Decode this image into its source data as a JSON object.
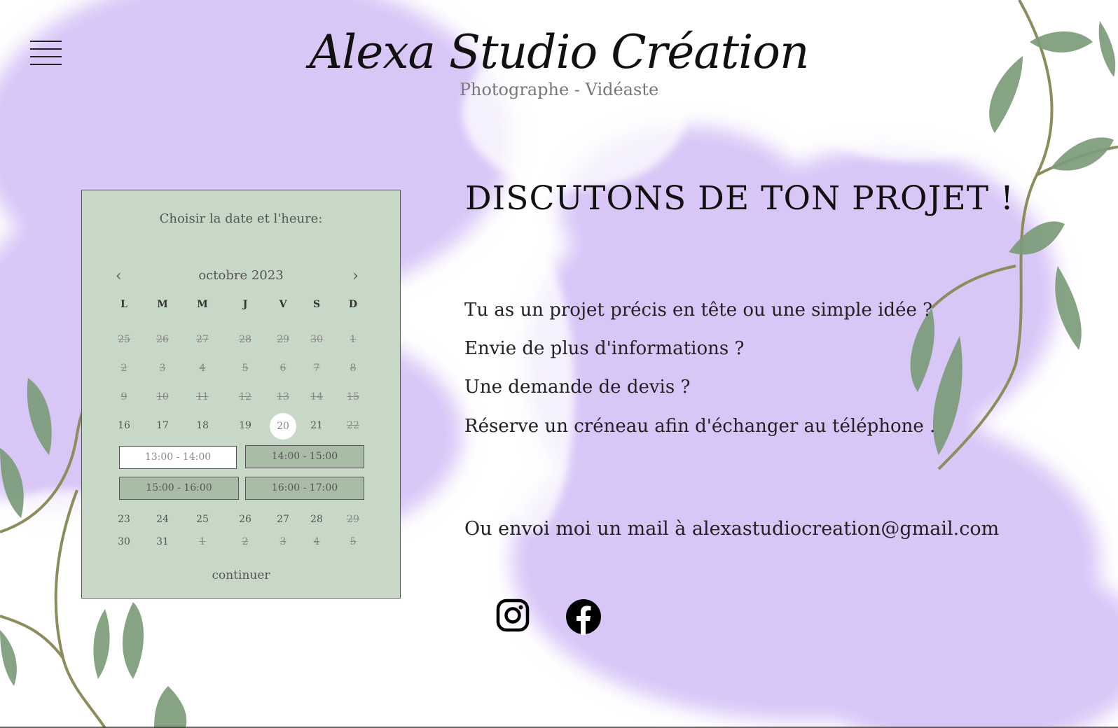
{
  "brand": {
    "title": "Alexa Studio Création",
    "subtitle": "Photographe - Vidéaste"
  },
  "booking": {
    "title": "Choisir la date et l'heure:",
    "month": "octobre 2023",
    "weekdays": [
      "L",
      "M",
      "M",
      "J",
      "V",
      "S",
      "D"
    ],
    "weeks": [
      [
        {
          "d": "25",
          "off": true
        },
        {
          "d": "26",
          "off": true
        },
        {
          "d": "27",
          "off": true
        },
        {
          "d": "28",
          "off": true
        },
        {
          "d": "29",
          "off": true
        },
        {
          "d": "30",
          "off": true
        },
        {
          "d": "1",
          "off": true
        }
      ],
      [
        {
          "d": "2",
          "off": true
        },
        {
          "d": "3",
          "off": true
        },
        {
          "d": "4",
          "off": true
        },
        {
          "d": "5",
          "off": true
        },
        {
          "d": "6",
          "off": true
        },
        {
          "d": "7",
          "off": true
        },
        {
          "d": "8",
          "off": true
        }
      ],
      [
        {
          "d": "9",
          "off": true
        },
        {
          "d": "10",
          "off": true
        },
        {
          "d": "11",
          "off": true
        },
        {
          "d": "12",
          "off": true
        },
        {
          "d": "13",
          "off": true
        },
        {
          "d": "14",
          "off": true
        },
        {
          "d": "15",
          "off": true
        }
      ],
      [
        {
          "d": "16",
          "off": false
        },
        {
          "d": "17",
          "off": false
        },
        {
          "d": "18",
          "off": false
        },
        {
          "d": "19",
          "off": false
        },
        {
          "d": "20",
          "off": false,
          "selected": true
        },
        {
          "d": "21",
          "off": false
        },
        {
          "d": "22",
          "off": true
        }
      ],
      [
        {
          "d": "23",
          "off": false
        },
        {
          "d": "24",
          "off": false
        },
        {
          "d": "25",
          "off": false
        },
        {
          "d": "26",
          "off": false
        },
        {
          "d": "27",
          "off": false
        },
        {
          "d": "28",
          "off": false
        },
        {
          "d": "29",
          "off": true
        }
      ],
      [
        {
          "d": "30",
          "off": false
        },
        {
          "d": "31",
          "off": false
        },
        {
          "d": "1",
          "off": true
        },
        {
          "d": "2",
          "off": true
        },
        {
          "d": "3",
          "off": true
        },
        {
          "d": "4",
          "off": true
        },
        {
          "d": "5",
          "off": true
        }
      ]
    ],
    "slots": [
      {
        "label": "13:00 - 14:00",
        "active": true
      },
      {
        "label": "14:00 - 15:00",
        "active": false
      },
      {
        "label": "15:00 - 16:00",
        "active": false
      },
      {
        "label": "16:00 - 17:00",
        "active": false
      }
    ],
    "continue_label": "continuer"
  },
  "contact": {
    "heading": "DISCUTONS DE TON PROJET !",
    "lines": [
      "Tu as un projet précis en tête ou une simple idée ?",
      "Envie de plus d'informations ?",
      "Une demande de devis ?",
      "Réserve un créneau afin d'échanger au téléphone ."
    ],
    "mail": "Ou envoi moi un mail à alexastudiocreation@gmail.com"
  },
  "social": {
    "icons": [
      "instagram-icon",
      "facebook-icon"
    ]
  },
  "colors": {
    "panel": "#c8d8c6",
    "slot": "#a9bda6",
    "watercolor": "#d7c4f6",
    "leaf": "#7c9c7a"
  }
}
